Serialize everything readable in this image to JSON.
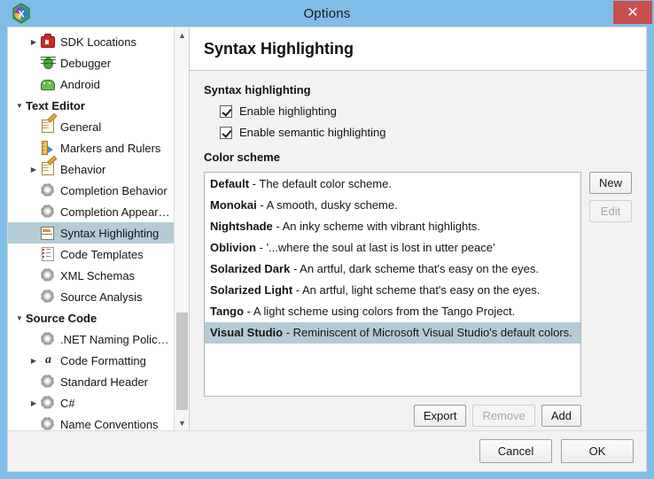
{
  "window": {
    "title": "Options",
    "app_icon": "xamarin-studio-logo",
    "close_label": "✕",
    "titlebar_color": "#7fbce8",
    "close_button_color": "#c7504f"
  },
  "sidebar": {
    "scrollbar": {
      "up_arrow": "▲",
      "down_arrow": "▼"
    },
    "items": [
      {
        "label": "SDK Locations",
        "icon": "toolbox-icon",
        "indent": 1,
        "expander": "collapsed",
        "group": false,
        "selected": false
      },
      {
        "label": "Debugger",
        "icon": "bug-icon",
        "indent": 1,
        "expander": "none",
        "group": false,
        "selected": false
      },
      {
        "label": "Android",
        "icon": "android-icon",
        "indent": 1,
        "expander": "none",
        "group": false,
        "selected": false
      },
      {
        "label": "Text Editor",
        "icon": "none",
        "indent": 0,
        "expander": "expanded",
        "group": true,
        "selected": false
      },
      {
        "label": "General",
        "icon": "pencil-icon",
        "indent": 1,
        "expander": "none",
        "group": false,
        "selected": false
      },
      {
        "label": "Markers and Rulers",
        "icon": "ruler-icon",
        "indent": 1,
        "expander": "none",
        "group": false,
        "selected": false
      },
      {
        "label": "Behavior",
        "icon": "pencil-icon",
        "indent": 1,
        "expander": "collapsed",
        "group": false,
        "selected": false
      },
      {
        "label": "Completion Behavior",
        "icon": "gear-icon",
        "indent": 1,
        "expander": "none",
        "group": false,
        "selected": false
      },
      {
        "label": "Completion Appearance",
        "icon": "gear-icon",
        "indent": 1,
        "expander": "none",
        "group": false,
        "selected": false
      },
      {
        "label": "Syntax Highlighting",
        "icon": "syntax-icon",
        "indent": 1,
        "expander": "none",
        "group": false,
        "selected": true
      },
      {
        "label": "Code Templates",
        "icon": "template-icon",
        "indent": 1,
        "expander": "none",
        "group": false,
        "selected": false
      },
      {
        "label": "XML Schemas",
        "icon": "gear-icon",
        "indent": 1,
        "expander": "none",
        "group": false,
        "selected": false
      },
      {
        "label": "Source Analysis",
        "icon": "gear-icon",
        "indent": 1,
        "expander": "none",
        "group": false,
        "selected": false
      },
      {
        "label": "Source Code",
        "icon": "none",
        "indent": 0,
        "expander": "expanded",
        "group": true,
        "selected": false
      },
      {
        "label": ".NET Naming Policies",
        "icon": "gear-icon",
        "indent": 1,
        "expander": "none",
        "group": false,
        "selected": false
      },
      {
        "label": "Code Formatting",
        "icon": "alpha-icon",
        "indent": 1,
        "expander": "collapsed",
        "group": false,
        "selected": false
      },
      {
        "label": "Standard Header",
        "icon": "gear-icon",
        "indent": 1,
        "expander": "none",
        "group": false,
        "selected": false
      },
      {
        "label": "C#",
        "icon": "gear-icon",
        "indent": 1,
        "expander": "collapsed",
        "group": false,
        "selected": false
      },
      {
        "label": "Name Conventions",
        "icon": "gear-icon",
        "indent": 1,
        "expander": "none",
        "group": false,
        "selected": false
      }
    ]
  },
  "main": {
    "title": "Syntax Highlighting",
    "syntax_section_label": "Syntax highlighting",
    "checkboxes": [
      {
        "label": "Enable highlighting",
        "checked": true
      },
      {
        "label": "Enable semantic highlighting",
        "checked": true
      }
    ],
    "color_scheme_label": "Color scheme",
    "schemes": [
      {
        "name": "Default",
        "description": "The default color scheme.",
        "selected": false
      },
      {
        "name": "Monokai",
        "description": "A smooth, dusky scheme.",
        "selected": false
      },
      {
        "name": "Nightshade",
        "description": "An inky scheme with vibrant highlights.",
        "selected": false
      },
      {
        "name": "Oblivion",
        "description": "'...where the soul at last is lost in utter peace'",
        "selected": false
      },
      {
        "name": "Solarized Dark",
        "description": "An artful, dark scheme that's easy on the eyes.",
        "selected": false
      },
      {
        "name": "Solarized Light",
        "description": "An artful, light scheme that's easy on the eyes.",
        "selected": false
      },
      {
        "name": "Tango",
        "description": "A light scheme using colors from the Tango Project.",
        "selected": false
      },
      {
        "name": "Visual Studio",
        "description": "Reminiscent of Microsoft Visual Studio's default colors.",
        "selected": true
      }
    ],
    "separator": " - ",
    "side_buttons": [
      {
        "label": "New",
        "enabled": true
      },
      {
        "label": "Edit",
        "enabled": false
      }
    ],
    "list_actions": [
      {
        "label": "Export",
        "enabled": true
      },
      {
        "label": "Remove",
        "enabled": false
      },
      {
        "label": "Add",
        "enabled": true
      }
    ],
    "selection_color": "#b4ccd6"
  },
  "footer": {
    "buttons": [
      {
        "label": "Cancel"
      },
      {
        "label": "OK"
      }
    ]
  }
}
